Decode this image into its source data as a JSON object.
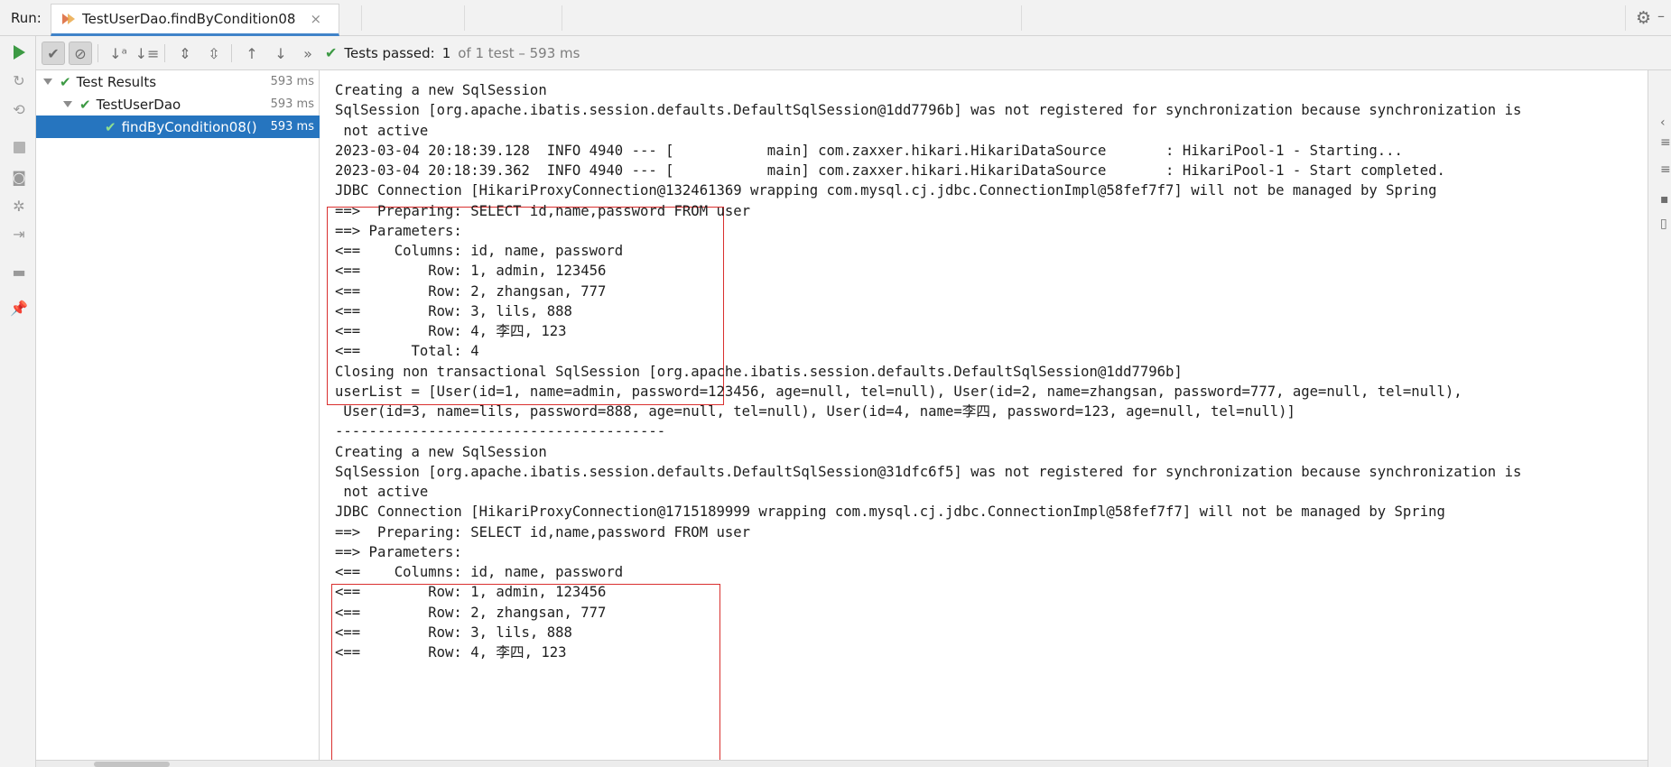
{
  "run_bar": {
    "label": "Run:",
    "tab_title": "TestUserDao.findByCondition08",
    "close_glyph": "×"
  },
  "toolbar": {
    "status_label": "Tests passed:",
    "passed_count": "1",
    "summary": "of 1 test – 593 ms"
  },
  "tree": {
    "items": [
      {
        "label": "Test Results",
        "time": "593 ms"
      },
      {
        "label": "TestUserDao",
        "time": "593 ms"
      },
      {
        "label": "findByCondition08()",
        "time": "593 ms"
      }
    ]
  },
  "console": {
    "lines": [
      "Creating a new SqlSession",
      "SqlSession [org.apache.ibatis.session.defaults.DefaultSqlSession@1dd7796b] was not registered for synchronization because synchronization is",
      " not active",
      "2023-03-04 20:18:39.128  INFO 4940 --- [           main] com.zaxxer.hikari.HikariDataSource       : HikariPool-1 - Starting...",
      "2023-03-04 20:18:39.362  INFO 4940 --- [           main] com.zaxxer.hikari.HikariDataSource       : HikariPool-1 - Start completed.",
      "JDBC Connection [HikariProxyConnection@132461369 wrapping com.mysql.cj.jdbc.ConnectionImpl@58fef7f7] will not be managed by Spring",
      "==>  Preparing: SELECT id,name,password FROM user",
      "==> Parameters: ",
      "<==    Columns: id, name, password",
      "<==        Row: 1, admin, 123456",
      "<==        Row: 2, zhangsan, 777",
      "<==        Row: 3, lils, 888",
      "<==        Row: 4, 李四, 123",
      "<==      Total: 4",
      "Closing non transactional SqlSession [org.apache.ibatis.session.defaults.DefaultSqlSession@1dd7796b]",
      "userList = [User(id=1, name=admin, password=123456, age=null, tel=null), User(id=2, name=zhangsan, password=777, age=null, tel=null),",
      " User(id=3, name=lils, password=888, age=null, tel=null), User(id=4, name=李四, password=123, age=null, tel=null)]",
      "---------------------------------------",
      "Creating a new SqlSession",
      "SqlSession [org.apache.ibatis.session.defaults.DefaultSqlSession@31dfc6f5] was not registered for synchronization because synchronization is",
      " not active",
      "JDBC Connection [HikariProxyConnection@1715189999 wrapping com.mysql.cj.jdbc.ConnectionImpl@58fef7f7] will not be managed by Spring",
      "==>  Preparing: SELECT id,name,password FROM user",
      "==> Parameters: ",
      "<==    Columns: id, name, password",
      "<==        Row: 1, admin, 123456",
      "<==        Row: 2, zhangsan, 777",
      "<==        Row: 3, lils, 888",
      "<==        Row: 4, 李四, 123"
    ]
  },
  "icons": {
    "tab_run_icon": "run-config-icon",
    "settings": "gear-icon",
    "check": "checkmark-icon"
  },
  "colors": {
    "accent": "#2675bf",
    "pass_green": "#3d9a44",
    "highlight_box": "#d9302f"
  }
}
